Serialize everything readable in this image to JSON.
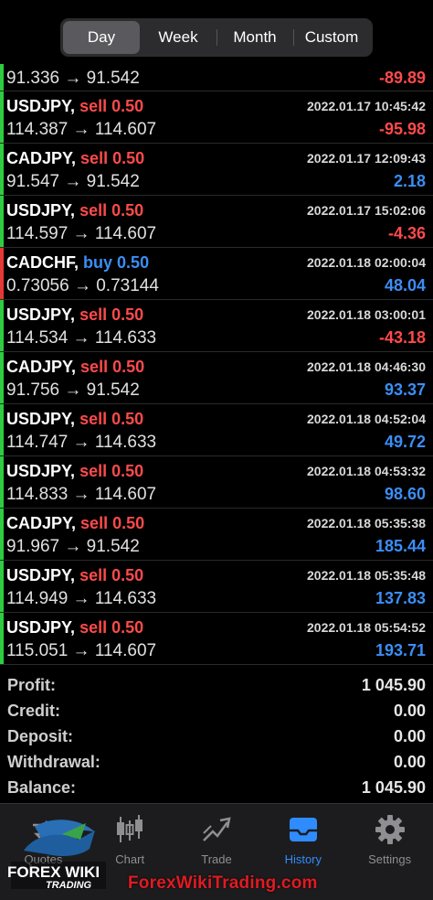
{
  "period_tabs": [
    {
      "label": "Day",
      "active": true
    },
    {
      "label": "Week",
      "active": false
    },
    {
      "label": "Month",
      "active": false
    },
    {
      "label": "Custom",
      "active": false
    }
  ],
  "deals": [
    {
      "symbol": "",
      "side": "",
      "volume": "",
      "prices": "91.336 → 91.542",
      "time": "",
      "profit": "-89.89",
      "sign": "neg",
      "bar": "green"
    },
    {
      "symbol": "USDJPY,",
      "side": "sell",
      "volume": "0.50",
      "prices": "114.387 → 114.607",
      "time": "2022.01.17 10:45:42",
      "profit": "-95.98",
      "sign": "neg",
      "bar": "green"
    },
    {
      "symbol": "CADJPY,",
      "side": "sell",
      "volume": "0.50",
      "prices": "91.547 → 91.542",
      "time": "2022.01.17 12:09:43",
      "profit": "2.18",
      "sign": "pos",
      "bar": "green"
    },
    {
      "symbol": "USDJPY,",
      "side": "sell",
      "volume": "0.50",
      "prices": "114.597 → 114.607",
      "time": "2022.01.17 15:02:06",
      "profit": "-4.36",
      "sign": "neg",
      "bar": "green"
    },
    {
      "symbol": "CADCHF,",
      "side": "buy",
      "volume": "0.50",
      "prices": "0.73056 → 0.73144",
      "time": "2022.01.18 02:00:04",
      "profit": "48.04",
      "sign": "pos",
      "bar": "red"
    },
    {
      "symbol": "USDJPY,",
      "side": "sell",
      "volume": "0.50",
      "prices": "114.534 → 114.633",
      "time": "2022.01.18 03:00:01",
      "profit": "-43.18",
      "sign": "neg",
      "bar": "green"
    },
    {
      "symbol": "CADJPY,",
      "side": "sell",
      "volume": "0.50",
      "prices": "91.756 → 91.542",
      "time": "2022.01.18 04:46:30",
      "profit": "93.37",
      "sign": "pos",
      "bar": "green"
    },
    {
      "symbol": "USDJPY,",
      "side": "sell",
      "volume": "0.50",
      "prices": "114.747 → 114.633",
      "time": "2022.01.18 04:52:04",
      "profit": "49.72",
      "sign": "pos",
      "bar": "green"
    },
    {
      "symbol": "USDJPY,",
      "side": "sell",
      "volume": "0.50",
      "prices": "114.833 → 114.607",
      "time": "2022.01.18 04:53:32",
      "profit": "98.60",
      "sign": "pos",
      "bar": "green"
    },
    {
      "symbol": "CADJPY,",
      "side": "sell",
      "volume": "0.50",
      "prices": "91.967 → 91.542",
      "time": "2022.01.18 05:35:38",
      "profit": "185.44",
      "sign": "pos",
      "bar": "green"
    },
    {
      "symbol": "USDJPY,",
      "side": "sell",
      "volume": "0.50",
      "prices": "114.949 → 114.633",
      "time": "2022.01.18 05:35:48",
      "profit": "137.83",
      "sign": "pos",
      "bar": "green"
    },
    {
      "symbol": "USDJPY,",
      "side": "sell",
      "volume": "0.50",
      "prices": "115.051 → 114.607",
      "time": "2022.01.18 05:54:52",
      "profit": "193.71",
      "sign": "pos",
      "bar": "green"
    }
  ],
  "summary": [
    {
      "label": "Profit:",
      "value": "1 045.90"
    },
    {
      "label": "Credit:",
      "value": "0.00"
    },
    {
      "label": "Deposit:",
      "value": "0.00"
    },
    {
      "label": "Withdrawal:",
      "value": "0.00"
    },
    {
      "label": "Balance:",
      "value": "1 045.90"
    }
  ],
  "tabbar": [
    {
      "label": "Quotes",
      "icon": "quotes-icon",
      "active": false
    },
    {
      "label": "Chart",
      "icon": "candlestick-chart-icon",
      "active": false
    },
    {
      "label": "Trade",
      "icon": "trade-trend-icon",
      "active": false
    },
    {
      "label": "History",
      "icon": "history-inbox-icon",
      "active": true
    },
    {
      "label": "Settings",
      "icon": "gear-icon",
      "active": false
    }
  ],
  "watermark": {
    "logo_text_top": "FOREX WIKI",
    "logo_text_bottom": "TRADING",
    "url": "ForexWikiTrading.com"
  },
  "colors": {
    "background": "#000000",
    "sell": "#ff4a4a",
    "buy": "#3b8ef5",
    "profit_negative": "#ff4a4a",
    "profit_positive": "#3b8ef5",
    "bar_green": "#2ecc40",
    "bar_red": "#e53935",
    "tab_active": "#2f8cff",
    "watermark_red": "#e11b22"
  }
}
